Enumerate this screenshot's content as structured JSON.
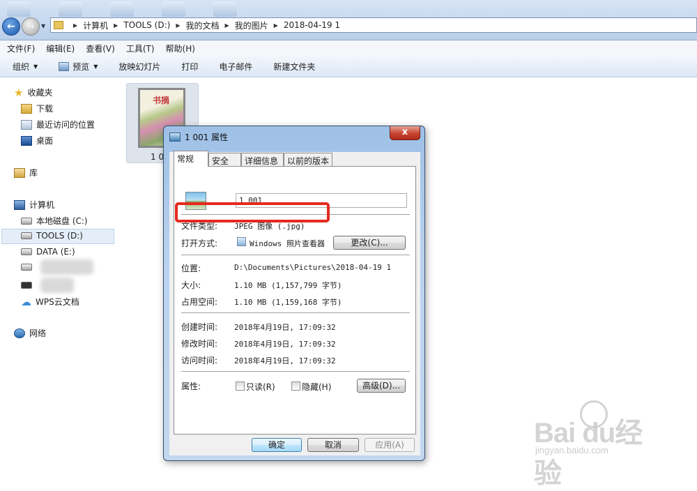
{
  "address_bar": {
    "crumbs": [
      "计算机",
      "TOOLS (D:)",
      "我的文档",
      "我的图片",
      "2018-04-19 1"
    ]
  },
  "menu": [
    "文件(F)",
    "编辑(E)",
    "查看(V)",
    "工具(T)",
    "帮助(H)"
  ],
  "toolbar": {
    "organize": "组织",
    "preview": "预览",
    "slideshow": "放映幻灯片",
    "print": "打印",
    "email": "电子邮件",
    "new_folder": "新建文件夹"
  },
  "sidebar": {
    "favorites": "收藏夹",
    "downloads": "下载",
    "recent": "最近访问的位置",
    "desktop": "桌面",
    "libraries": "库",
    "computer": "计算机",
    "drive_c": "本地磁盘 (C:)",
    "drive_d": "TOOLS (D:)",
    "drive_e": "DATA (E:)",
    "wps_cloud": "WPS云文档",
    "network": "网络"
  },
  "file_item": {
    "thumb_text": "书摘",
    "label": "1 0"
  },
  "dialog": {
    "title": "1 001 属性",
    "close": "x",
    "tabs": [
      "常规",
      "安全",
      "详细信息",
      "以前的版本"
    ],
    "file_name": "1 001",
    "file_type_label": "文件类型:",
    "file_type_value": "JPEG 图像 (.jpg)",
    "open_with_label": "打开方式:",
    "open_with_value": "Windows 照片查看器",
    "change_button": "更改(C)...",
    "location_label": "位置:",
    "location_value": "D:\\Documents\\Pictures\\2018-04-19 1",
    "size_label": "大小:",
    "size_value": "1.10 MB (1,157,799 字节)",
    "size_on_disk_label": "占用空间:",
    "size_on_disk_value": "1.10 MB (1,159,168 字节)",
    "created_label": "创建时间:",
    "created_value": "2018年4月19日, 17:09:32",
    "modified_label": "修改时间:",
    "modified_value": "2018年4月19日, 17:09:32",
    "accessed_label": "访问时间:",
    "accessed_value": "2018年4月19日, 17:09:32",
    "attributes_label": "属性:",
    "readonly_label": "只读(R)",
    "hidden_label": "隐藏(H)",
    "advanced_button": "高级(D)...",
    "ok_button": "确定",
    "cancel_button": "取消",
    "apply_button": "应用(A)"
  },
  "watermark": {
    "brand": "Bai du经验",
    "url": "jingyan.baidu.com"
  },
  "colors": {
    "highlight": "#e52a1f",
    "selection": "#e5eef8"
  }
}
